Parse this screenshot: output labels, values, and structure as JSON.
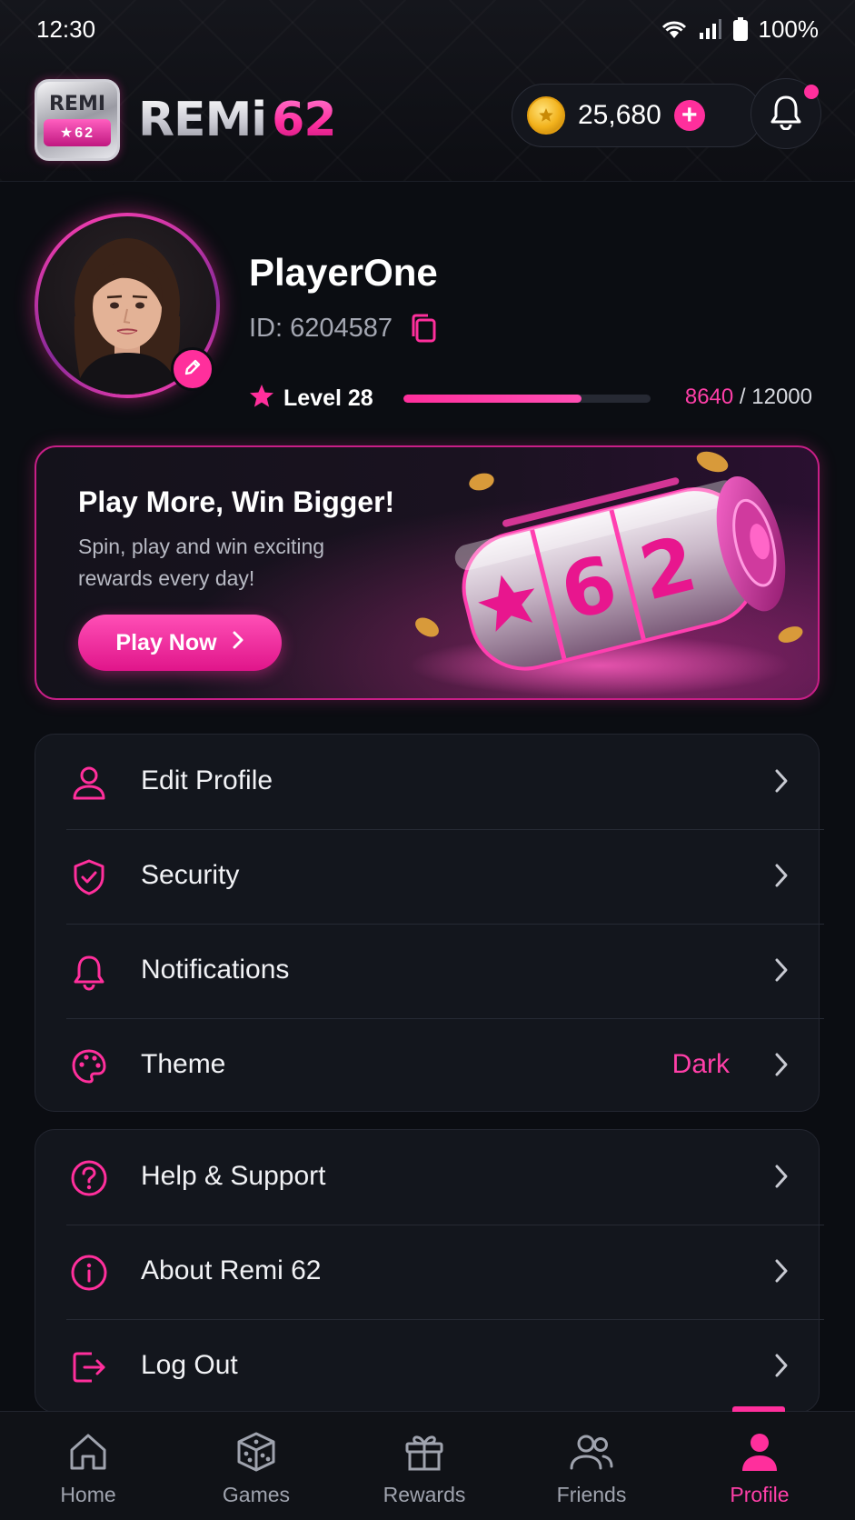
{
  "status_bar": {
    "time": "12:30",
    "battery": "100%"
  },
  "header": {
    "logo_top": "REMI",
    "logo_reel": "★62",
    "brand_word": "REMi",
    "brand_number": "62",
    "coins": "25,680",
    "coin_plus": "+",
    "has_notification": true
  },
  "profile": {
    "username": "PlayerOne",
    "player_id": "ID: 6204587",
    "level_label": "Level 28",
    "xp_current": "8640",
    "xp_separator": " / ",
    "xp_max": "12000",
    "xp_progress": 0.72
  },
  "promo": {
    "title": "Play More, Win Bigger!",
    "subtitle": "Spin, play and win exciting rewards every day!",
    "button_label": "Play Now",
    "art_text": "62"
  },
  "menu_primary": [
    {
      "label": "Edit Profile",
      "icon": "user-icon",
      "value": ""
    },
    {
      "label": "Security",
      "icon": "shield-check-icon",
      "value": ""
    },
    {
      "label": "Notifications",
      "icon": "bell-icon",
      "value": ""
    },
    {
      "label": "Theme",
      "icon": "palette-icon",
      "value": "Dark"
    }
  ],
  "menu_secondary": [
    {
      "label": "Help & Support",
      "icon": "help-circle-icon"
    },
    {
      "label": "About Remi 62",
      "icon": "info-circle-icon"
    },
    {
      "label": "Log Out",
      "icon": "logout-icon"
    }
  ],
  "bottom_nav": [
    {
      "label": "Home",
      "icon": "home-icon",
      "active": false
    },
    {
      "label": "Games",
      "icon": "dice-icon",
      "active": false
    },
    {
      "label": "Rewards",
      "icon": "gift-icon",
      "active": false
    },
    {
      "label": "Friends",
      "icon": "friends-icon",
      "active": false
    },
    {
      "label": "Profile",
      "icon": "profile-icon",
      "active": true
    }
  ],
  "colors": {
    "accent": "#ff2f9c",
    "background": "#0b0d12",
    "card": "#13161d",
    "muted_text": "#9fa3ae"
  }
}
